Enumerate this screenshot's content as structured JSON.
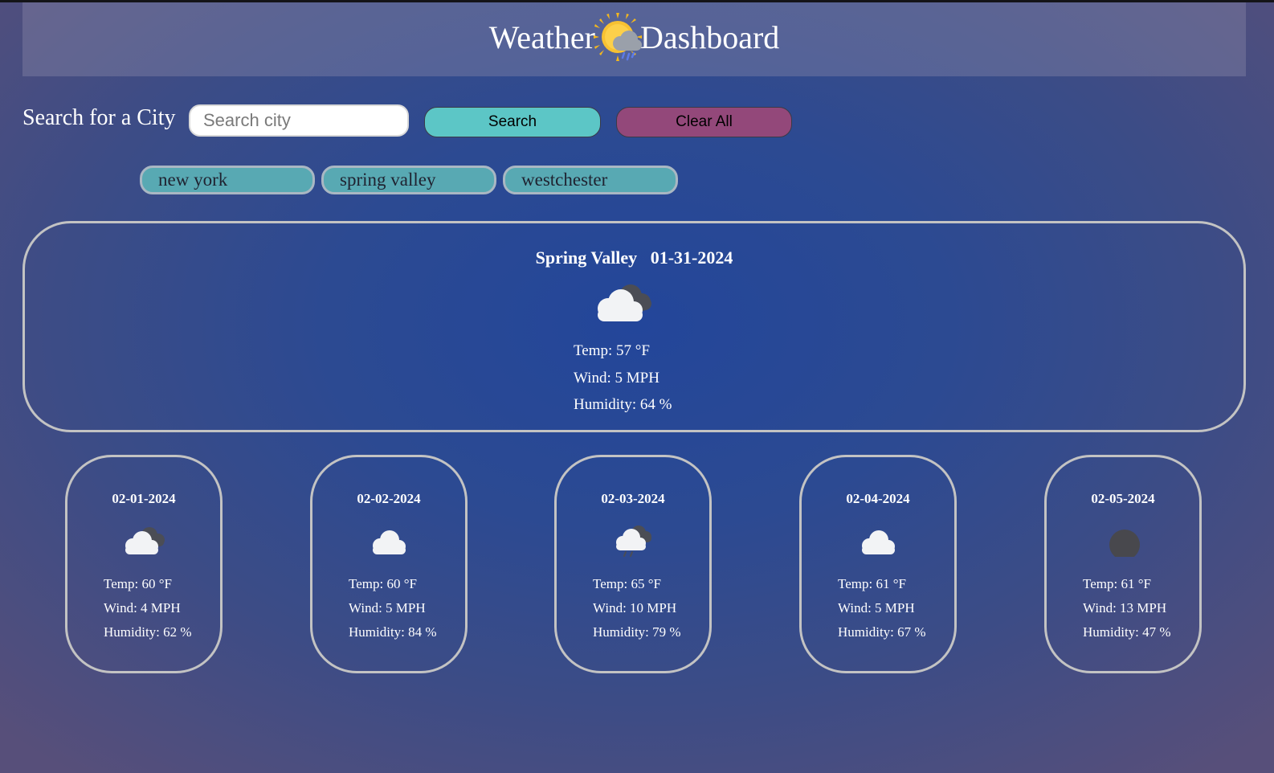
{
  "header": {
    "title_left": "Weather",
    "title_right": "Dashboard",
    "logo_icon": "sun-behind-rain-cloud-icon"
  },
  "search": {
    "label": "Search for a City",
    "placeholder": "Search city",
    "value": "",
    "search_button": "Search",
    "clear_button": "Clear All"
  },
  "history": [
    "new york",
    "spring valley",
    "westchester"
  ],
  "today": {
    "city": "Spring Valley",
    "date": "01-31-2024",
    "icon": "broken-clouds-icon",
    "temp": "Temp: 57 °F",
    "wind": "Wind: 5 MPH",
    "humidity": "Humidity: 64 %"
  },
  "forecast": [
    {
      "date": "02-01-2024",
      "icon": "broken-clouds-icon",
      "temp": "Temp: 60 °F",
      "wind": "Wind: 4 MPH",
      "humidity": "Humidity: 62 %"
    },
    {
      "date": "02-02-2024",
      "icon": "cloud-icon",
      "temp": "Temp: 60 °F",
      "wind": "Wind: 5 MPH",
      "humidity": "Humidity: 84 %"
    },
    {
      "date": "02-03-2024",
      "icon": "rain-cloud-icon",
      "temp": "Temp: 65 °F",
      "wind": "Wind: 10 MPH",
      "humidity": "Humidity: 79 %"
    },
    {
      "date": "02-04-2024",
      "icon": "cloud-icon",
      "temp": "Temp: 61 °F",
      "wind": "Wind: 5 MPH",
      "humidity": "Humidity: 67 %"
    },
    {
      "date": "02-05-2024",
      "icon": "clear-night-icon",
      "temp": "Temp: 61 °F",
      "wind": "Wind: 13 MPH",
      "humidity": "Humidity: 47 %"
    }
  ],
  "colors": {
    "search_button": "#5cc6c6",
    "clear_button": "#93487a",
    "history_chip": "#58a9b3",
    "card_border": "#c3c3c3"
  }
}
